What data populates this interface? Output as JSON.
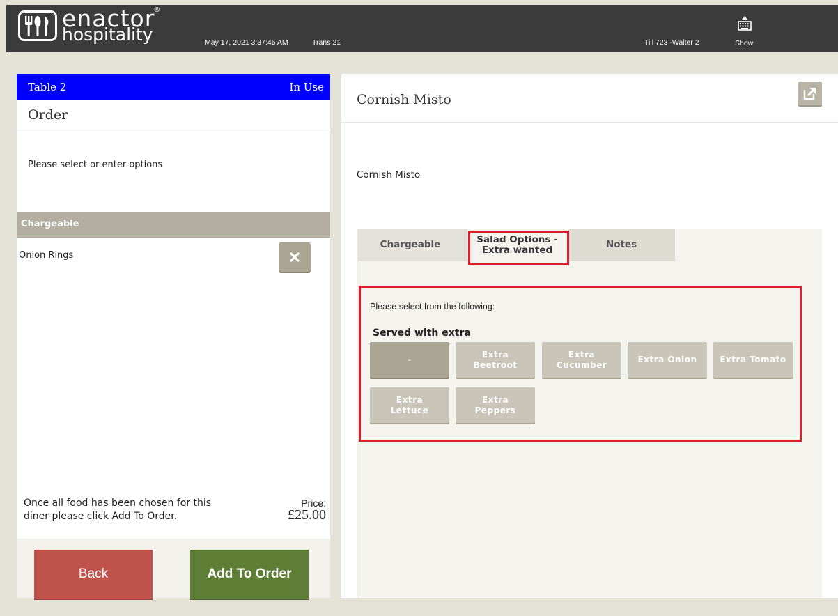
{
  "header": {
    "logo_line1": "enactor",
    "logo_line2": "hospitality",
    "logo_tm": "®",
    "datetime": "May 17, 2021 3:37:45 AM",
    "trans": "Trans 21",
    "till": "Till 723 -Waiter 2",
    "keyboard_label": "Show",
    "keyboard_icon": "keyboard-icon"
  },
  "left": {
    "table_name": "Table 2",
    "table_status": "In Use",
    "order_title": "Order",
    "prompt": "Please select or enter options",
    "section_header": "Chargeable",
    "items": [
      {
        "label": "Onion Rings"
      }
    ],
    "footer_message": "Once all food has been chosen for this diner please click Add To Order.",
    "price_label": "Price:",
    "price_value": "£25.00",
    "back_label": "Back",
    "add_label": "Add To Order"
  },
  "right": {
    "title": "Cornish Misto",
    "subtitle": "Cornish Misto",
    "tabs": [
      {
        "label": "Chargeable"
      },
      {
        "label": "Salad Options - Extra wanted"
      },
      {
        "label": "Notes"
      }
    ],
    "options_prompt": "Please select from the following:",
    "options_heading": "Served with extra",
    "options": [
      {
        "label": "-"
      },
      {
        "label": "Extra Beetroot"
      },
      {
        "label": "Extra Cucumber"
      },
      {
        "label": "Extra Onion"
      },
      {
        "label": "Extra Tomato"
      },
      {
        "label": "Extra Lettuce"
      },
      {
        "label": "Extra Peppers"
      }
    ],
    "selected_option": "-"
  },
  "colors": {
    "table_bar": "#0000ff",
    "back_button": "#c0524c",
    "add_button": "#5e7d35",
    "highlight": "#e01d2a"
  }
}
